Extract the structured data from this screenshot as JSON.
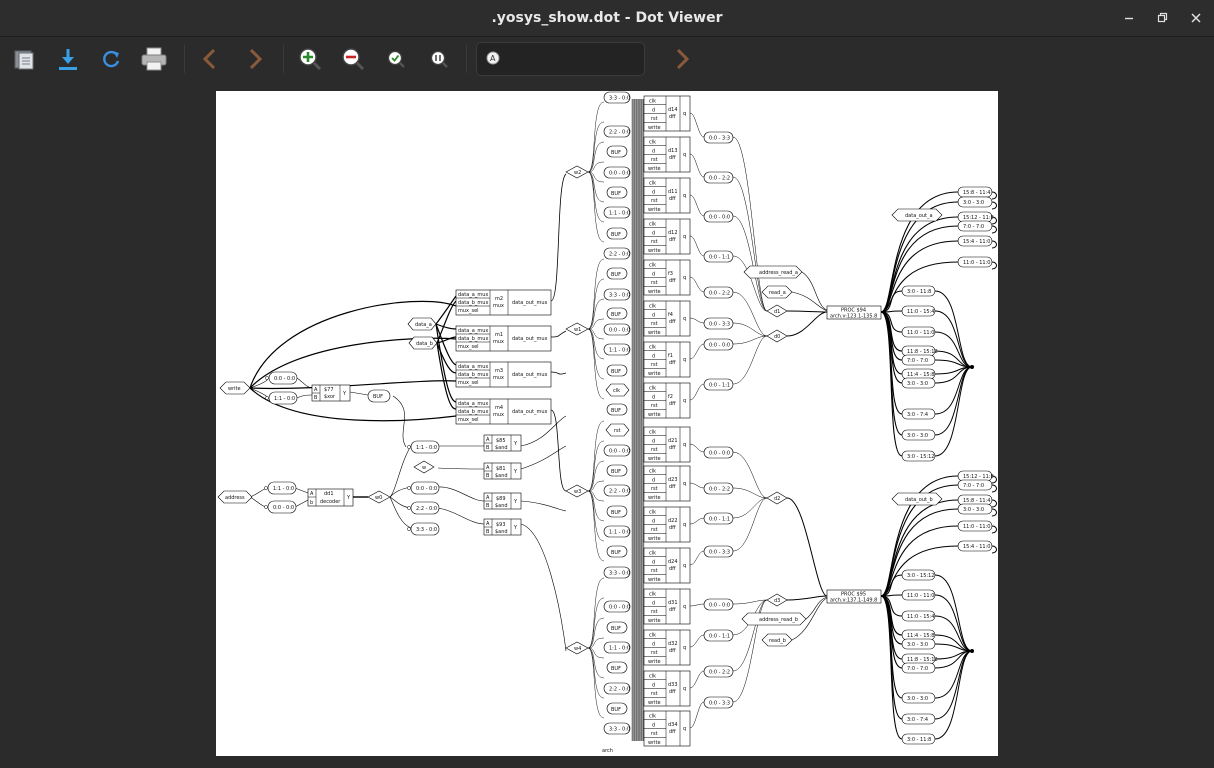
{
  "window": {
    "title": ".yosys_show.dot - Dot Viewer",
    "controls": [
      "minimize",
      "maximize",
      "close"
    ]
  },
  "toolbar": {
    "buttons": [
      {
        "name": "open",
        "icon": "folder-icon"
      },
      {
        "name": "save",
        "icon": "download-icon"
      },
      {
        "name": "reload",
        "icon": "reload-icon"
      },
      {
        "name": "print",
        "icon": "printer-icon"
      },
      {
        "name": "back",
        "icon": "chevron-left-icon"
      },
      {
        "name": "forward",
        "icon": "chevron-right-icon"
      },
      {
        "name": "zoom-in",
        "icon": "zoom-in-icon"
      },
      {
        "name": "zoom-out",
        "icon": "zoom-out-icon"
      },
      {
        "name": "zoom-fit",
        "icon": "zoom-fit-icon"
      },
      {
        "name": "zoom-100",
        "icon": "zoom-100-icon"
      }
    ],
    "search": {
      "value": "",
      "placeholder": ""
    },
    "find_next": {
      "icon": "chevron-right-icon"
    }
  },
  "graph": {
    "caption": "arch",
    "ports": {
      "write": "write",
      "address": "address",
      "data_a": "data_a",
      "data_b": "data_b",
      "address_read_a": "address_read_a",
      "read_a": "read_a",
      "address_read_b": "address_read_b",
      "read_b": "read_b",
      "data_out_a": "data_out_a",
      "data_out_b": "data_out_b",
      "clk": "clk",
      "rst": "rst"
    },
    "muxes": [
      {
        "name": "m2",
        "type": "mux",
        "inputs": [
          "data_a_mux",
          "data_b_mux",
          "mux_sel"
        ],
        "output": "data_out_mux"
      },
      {
        "name": "m1",
        "type": "mux",
        "inputs": [
          "data_a_mux",
          "data_b_mux",
          "mux_sel"
        ],
        "output": "data_out_mux"
      },
      {
        "name": "m3",
        "type": "mux",
        "inputs": [
          "data_a_mux",
          "data_b_mux",
          "mux_sel"
        ],
        "output": "data_out_mux"
      },
      {
        "name": "m4",
        "type": "mux",
        "inputs": [
          "data_a_mux",
          "data_b_mux",
          "mux_sel"
        ],
        "output": "data_out_mux"
      }
    ],
    "gates": {
      "xor": {
        "name": "$77",
        "type": "$xor",
        "inputs": [
          "A",
          "B"
        ],
        "output": "Y"
      },
      "decoder": {
        "name": "dd1",
        "type": "decoder",
        "inputs": [
          "A",
          "b"
        ],
        "output": "Y"
      },
      "ands": [
        {
          "name": "$85",
          "type": "$and"
        },
        {
          "name": "$81",
          "type": "$and"
        },
        {
          "name": "$89",
          "type": "$and"
        },
        {
          "name": "$93",
          "type": "$and"
        }
      ],
      "and_pins": [
        "A",
        "B",
        "Y"
      ]
    },
    "buf": "BUF",
    "wires": {
      "w0": "w0",
      "w1": "w1",
      "w2": "w2",
      "w3": "w3",
      "w4": "w4",
      "w": "w"
    },
    "slices_left": [
      "0:0 - 0:0",
      "1:1 - 0:0",
      "1:1 - 0:0",
      "0:0 - 0:0",
      "1:1 - 0:0",
      "0:0 - 0:0",
      "2:2 - 0:0",
      "3:3 - 0:0"
    ],
    "slices_mid": [
      "3:3 - 0:0",
      "2:2 - 0:0",
      "0:0 - 0:0",
      "1:1 - 0:0",
      "2:2 - 0:0",
      "3:3 - 0:0",
      "0:0 - 0:0",
      "1:1 - 0:0",
      "0:0 - 0:0",
      "2:2 - 0:0",
      "1:1 - 0:0",
      "3:3 - 0:0",
      "0:0 - 0:0",
      "1:1 - 0:0",
      "2:2 - 0:0",
      "3:3 - 0:0"
    ],
    "dffs": [
      "d14",
      "d13",
      "d11",
      "d12",
      "f3",
      "f4",
      "f1",
      "f2",
      "d21",
      "d23",
      "d22",
      "d24",
      "d31",
      "d32",
      "d33",
      "d34"
    ],
    "dff_type": "dff",
    "dff_pins": [
      "clk",
      "d",
      "rst",
      "write"
    ],
    "dff_out": "q",
    "q_slices": [
      "0:0 - 3:3",
      "0:0 - 2:2",
      "0:0 - 0:0",
      "0:0 - 1:1",
      "0:0 - 2:2",
      "0:0 - 3:3",
      "0:0 - 0:0",
      "0:0 - 1:1",
      "0:0 - 0:0",
      "0:0 - 2:2",
      "0:0 - 1:1",
      "0:0 - 3:3",
      "0:0 - 0:0",
      "0:0 - 1:1",
      "0:0 - 2:2",
      "0:0 - 3:3"
    ],
    "merge": [
      "d1",
      "d0",
      "d2",
      "d3"
    ],
    "procs": [
      {
        "name": "PROC $94",
        "src": "arch.v:123.1-135.8"
      },
      {
        "name": "PROC $95",
        "src": "arch.v:137.1-149.8"
      }
    ],
    "out_a_slices": [
      "15:8 - 11:4",
      "3:0 - 3:0",
      "15:12 - 11:8",
      "7:0 - 7:0",
      "15:4 - 11:0",
      "11:0 - 11:0"
    ],
    "out_b_slices": [
      "15:12 - 11:8",
      "7:0 - 7:0",
      "15:8 - 11:4",
      "3:0 - 3:0",
      "11:0 - 11:0",
      "15:4 - 11:0"
    ],
    "proc_a_slices": [
      "3:0 - 11:8",
      "11:0 - 15:4",
      "11:0 - 11:0",
      "11:8 - 15:12",
      "7:0 - 7:0",
      "11:4 - 15:8",
      "3:0 - 3:0",
      "3:0 - 7:4",
      "3:0 - 3:0",
      "3:0 - 15:12"
    ],
    "proc_b_slices": [
      "3:0 - 15:12",
      "11:0 - 11:0",
      "11:0 - 15:4",
      "11:4 - 15:8",
      "3:0 - 3:0",
      "11:8 - 15:12",
      "7:0 - 7:0",
      "3:0 - 3:0",
      "3:0 - 7:4",
      "3:0 - 11:8"
    ]
  }
}
